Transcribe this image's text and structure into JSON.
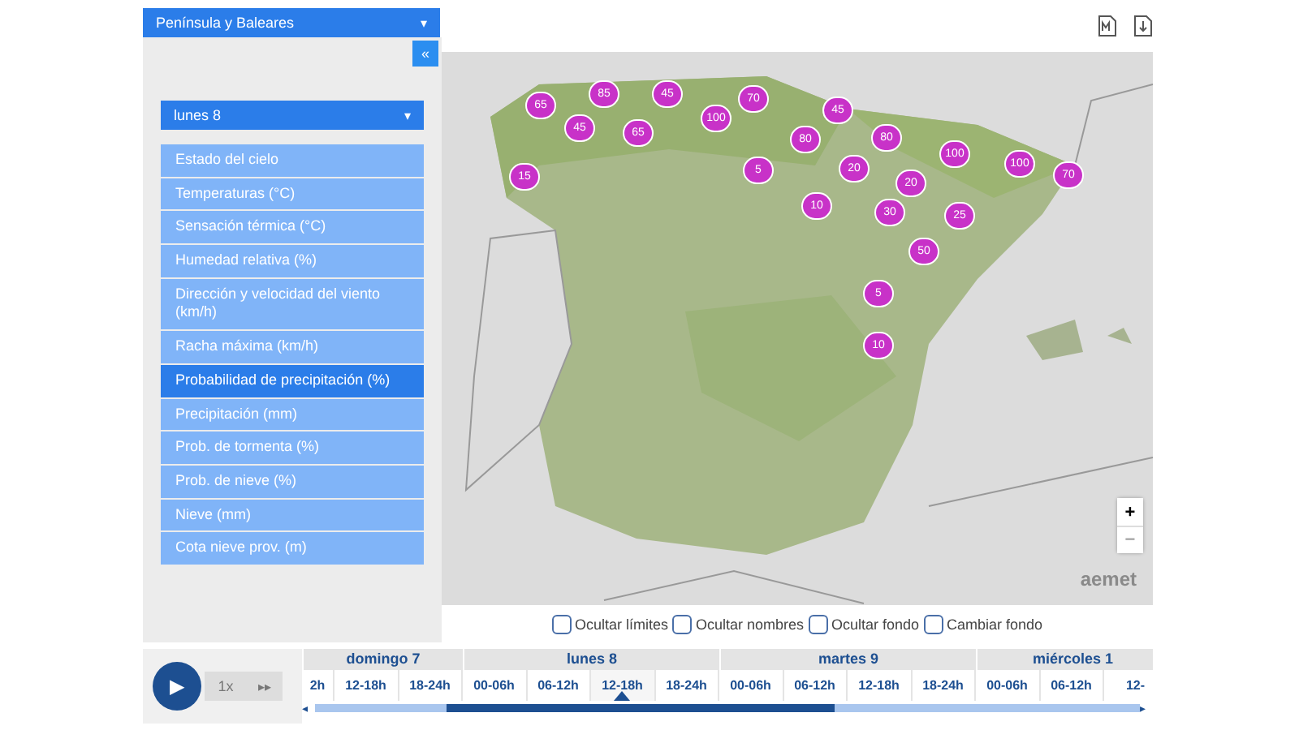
{
  "region_select": {
    "value": "Península y Baleares",
    "caret": "▾"
  },
  "collapse_button": "«",
  "day_select": {
    "value": "lunes 8",
    "caret": "▾"
  },
  "variables": [
    {
      "label": "Estado del cielo",
      "selected": false
    },
    {
      "label": "Temperaturas (°C)",
      "selected": false
    },
    {
      "label": "Sensación térmica (°C)",
      "selected": false
    },
    {
      "label": "Humedad relativa (%)",
      "selected": false
    },
    {
      "label": "Dirección y velocidad del viento (km/h)",
      "selected": false
    },
    {
      "label": "Racha máxima (km/h)",
      "selected": false
    },
    {
      "label": "Probabilidad de precipitación (%)",
      "selected": true
    },
    {
      "label": "Precipitación (mm)",
      "selected": false
    },
    {
      "label": "Prob. de tormenta (%)",
      "selected": false
    },
    {
      "label": "Prob. de nieve (%)",
      "selected": false
    },
    {
      "label": "Nieve (mm)",
      "selected": false
    },
    {
      "label": "Cota nieve prov. (m)",
      "selected": false
    }
  ],
  "map": {
    "kind": "picture",
    "logo": "aemet",
    "zoom_in": "+",
    "zoom_out": "−",
    "markers": [
      "65",
      "85",
      "45",
      "70",
      "45",
      "45",
      "65",
      "100",
      "80",
      "80",
      "15",
      "5",
      "20",
      "20",
      "100",
      "100",
      "70",
      "10",
      "30",
      "25",
      "50",
      "5",
      "10"
    ]
  },
  "map_options": [
    {
      "label": "Ocultar límites",
      "checked": false
    },
    {
      "label": "Ocultar nombres",
      "checked": false
    },
    {
      "label": "Ocultar fondo",
      "checked": false
    },
    {
      "label": "Cambiar fondo",
      "checked": false
    }
  ],
  "player": {
    "play": "▶",
    "speed": "1x",
    "fast_forward": "▸▸"
  },
  "timeline": {
    "left_arrow": "◂",
    "right_arrow": "▸",
    "days": [
      {
        "label": "domingo 7",
        "slots": [
          {
            "label": "2h",
            "selected": false
          },
          {
            "label": "12-18h",
            "selected": false
          },
          {
            "label": "18-24h",
            "selected": false
          }
        ]
      },
      {
        "label": "lunes 8",
        "slots": [
          {
            "label": "00-06h",
            "selected": false
          },
          {
            "label": "06-12h",
            "selected": false
          },
          {
            "label": "12-18h",
            "selected": true
          },
          {
            "label": "18-24h",
            "selected": false
          }
        ]
      },
      {
        "label": "martes 9",
        "slots": [
          {
            "label": "00-06h",
            "selected": false
          },
          {
            "label": "06-12h",
            "selected": false
          },
          {
            "label": "12-18h",
            "selected": false
          },
          {
            "label": "18-24h",
            "selected": false
          }
        ]
      },
      {
        "label": "miércoles 1",
        "slots": [
          {
            "label": "00-06h",
            "selected": false
          },
          {
            "label": "06-12h",
            "selected": false
          },
          {
            "label": "12-",
            "selected": false
          }
        ]
      }
    ]
  }
}
